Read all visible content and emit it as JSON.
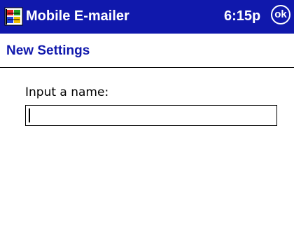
{
  "titlebar": {
    "app_title": "Mobile E-mailer",
    "clock": "6:15p",
    "ok_label": "ok",
    "start_icon": "windows-flag-icon",
    "background_color": "#1018ac",
    "text_color": "#ffffff"
  },
  "header": {
    "title": "New Settings",
    "title_color": "#1018ac"
  },
  "form": {
    "name_label": "Input a name:",
    "name_value": "",
    "name_placeholder": ""
  }
}
